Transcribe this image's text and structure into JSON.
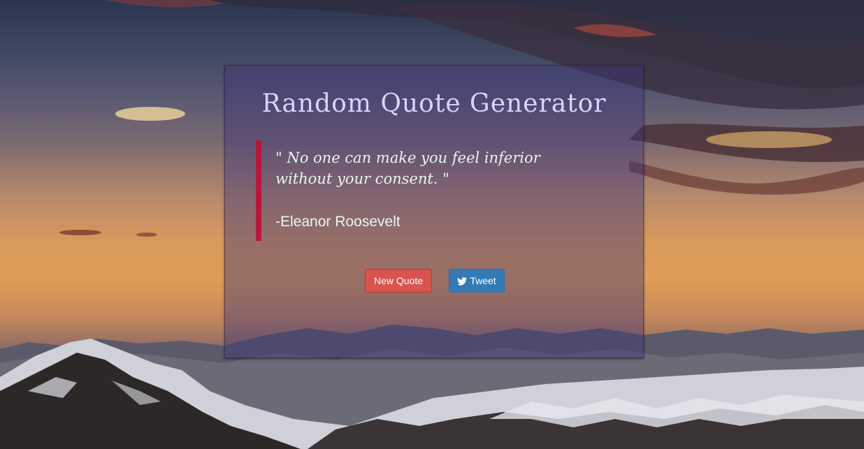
{
  "app": {
    "title": "Random Quote Generator"
  },
  "quote": {
    "text": "\" No one can make you feel inferior without your consent. \"",
    "author": "-Eleanor Roosevelt"
  },
  "buttons": {
    "new_quote_label": "New Quote",
    "tweet_label": "Tweet",
    "tweet_icon": "twitter-icon"
  },
  "colors": {
    "title": "#d9d4ff",
    "quote_border": "#b5173d",
    "new_quote_button": "#d9534f",
    "tweet_button": "#337ab7",
    "card_overlay": "rgba(60, 50, 120, 0.42)"
  }
}
